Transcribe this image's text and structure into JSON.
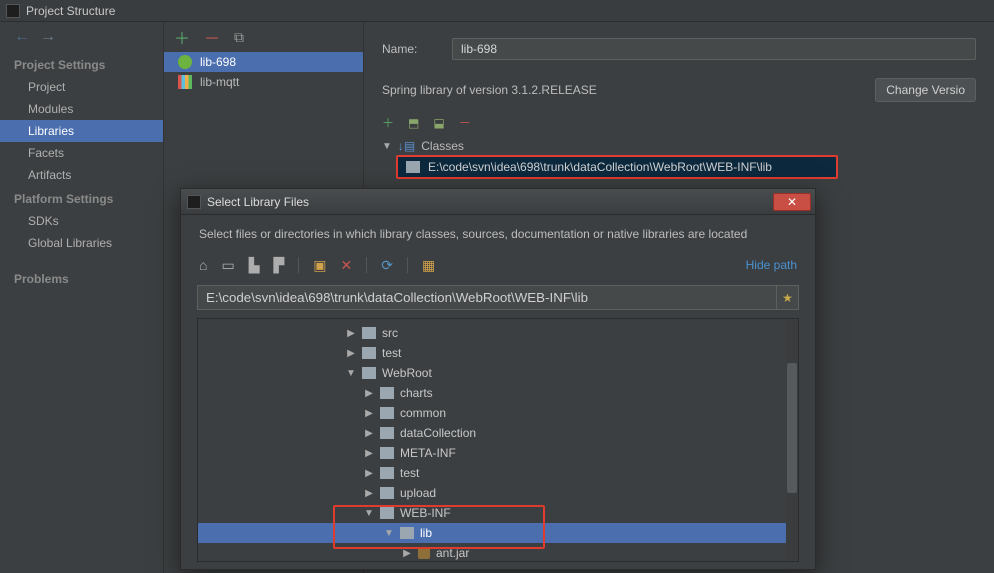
{
  "window": {
    "title": "Project Structure"
  },
  "sidebar": {
    "sections": {
      "project": "Project Settings",
      "platform": "Platform Settings"
    },
    "items": {
      "project": "Project",
      "modules": "Modules",
      "libraries": "Libraries",
      "facets": "Facets",
      "artifacts": "Artifacts",
      "sdks": "SDKs",
      "global": "Global Libraries",
      "problems": "Problems"
    }
  },
  "lib_list": {
    "items": [
      {
        "name": "lib-698",
        "icon": "spring"
      },
      {
        "name": "lib-mqtt",
        "icon": "bars"
      }
    ]
  },
  "detail": {
    "name_label": "Name:",
    "name_value": "lib-698",
    "version_text": "Spring library of version 3.1.2.RELEASE",
    "change_btn": "Change Versio",
    "classes_label": "Classes",
    "classes_path": "E:\\code\\svn\\idea\\698\\trunk\\dataCollection\\WebRoot\\WEB-INF\\lib"
  },
  "dialog": {
    "title": "Select Library Files",
    "instruction": "Select files or directories in which library classes, sources, documentation or native libraries are located",
    "hide_path": "Hide path",
    "path_value": "E:\\code\\svn\\idea\\698\\trunk\\dataCollection\\WebRoot\\WEB-INF\\lib",
    "tree": [
      {
        "name": "src",
        "indent": "ind1",
        "tri": "▶"
      },
      {
        "name": "test",
        "indent": "ind1",
        "tri": "▶"
      },
      {
        "name": "WebRoot",
        "indent": "ind1",
        "tri": "▼"
      },
      {
        "name": "charts",
        "indent": "ind2",
        "tri": "▶"
      },
      {
        "name": "common",
        "indent": "ind2",
        "tri": "▶"
      },
      {
        "name": "dataCollection",
        "indent": "ind2",
        "tri": "▶"
      },
      {
        "name": "META-INF",
        "indent": "ind2",
        "tri": "▶"
      },
      {
        "name": "test",
        "indent": "ind2",
        "tri": "▶"
      },
      {
        "name": "upload",
        "indent": "ind2",
        "tri": "▶"
      },
      {
        "name": "WEB-INF",
        "indent": "ind2",
        "tri": "▼"
      },
      {
        "name": "lib",
        "indent": "ind3",
        "tri": "▼",
        "selected": true
      },
      {
        "name": "ant.jar",
        "indent": "ind4",
        "tri": "▶",
        "jar": true
      }
    ]
  }
}
